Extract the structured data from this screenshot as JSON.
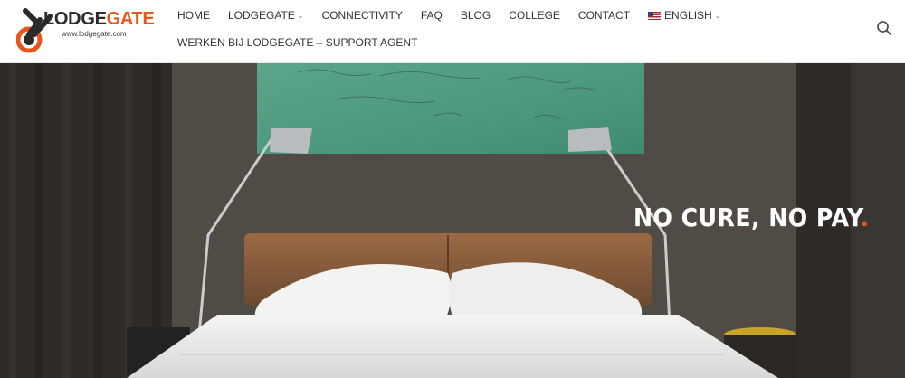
{
  "logo": {
    "name_dark": "LODGE",
    "name_accent": "GATE",
    "url": "www.lodgegate.com"
  },
  "nav": {
    "items": [
      {
        "label": "HOME"
      },
      {
        "label": "LODGEGATE"
      },
      {
        "label": "CONNECTIVITY"
      },
      {
        "label": "FAQ"
      },
      {
        "label": "BLOG"
      },
      {
        "label": "COLLEGE"
      },
      {
        "label": "CONTACT"
      },
      {
        "label": "ENGLISH"
      }
    ],
    "second_row": "WERKEN BIJ LODGEGATE – SUPPORT AGENT"
  },
  "hero": {
    "tagline": "NO CURE, NO PAY",
    "tagline_punct": "."
  },
  "colors": {
    "accent": "#e8561c",
    "dark": "#2b2b2b"
  },
  "icons": [
    "search-icon",
    "chevron-down-icon",
    "us-flag-icon"
  ]
}
